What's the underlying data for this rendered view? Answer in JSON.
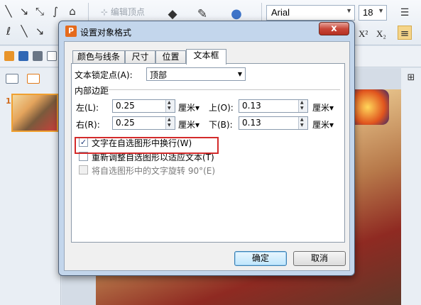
{
  "toolbar": {
    "edit_vertex_label": "编辑顶点",
    "font_name": "Arial",
    "font_size": "18",
    "superscript_label": "X²",
    "subscript_label": "X₂"
  },
  "dialog": {
    "title": "设置对象格式",
    "icon_letter": "P",
    "close_label": "x",
    "tabs": [
      {
        "label": "颜色与线条",
        "active": false
      },
      {
        "label": "尺寸",
        "active": false
      },
      {
        "label": "位置",
        "active": false
      },
      {
        "label": "文本框",
        "active": true
      }
    ],
    "anchor": {
      "label": "文本锁定点(A):",
      "value": "顶部"
    },
    "margins_header": "内部边距",
    "margins": {
      "left": {
        "label": "左(L):",
        "value": "0.25",
        "unit": "厘米▾"
      },
      "top": {
        "label": "上(O):",
        "value": "0.13",
        "unit": "厘米▾"
      },
      "right": {
        "label": "右(R):",
        "value": "0.25",
        "unit": "厘米▾"
      },
      "bottom": {
        "label": "下(B):",
        "value": "0.13",
        "unit": "厘米▾"
      }
    },
    "options": {
      "wrap": {
        "label": "文字在自选图形中换行(W)",
        "checked": true
      },
      "resize": {
        "label": "重新调整自选图形以适应文本(T)",
        "checked": false
      },
      "rotate": {
        "label": "将自选图形中的文字旋转 90°(E)",
        "checked": false,
        "disabled": true
      }
    },
    "ok_label": "确定",
    "cancel_label": "取消"
  },
  "slide_panel": {
    "slide_number": "1"
  },
  "colors": {
    "accent": "#d32b2b",
    "dialog_frame": "#c3d6ec"
  }
}
